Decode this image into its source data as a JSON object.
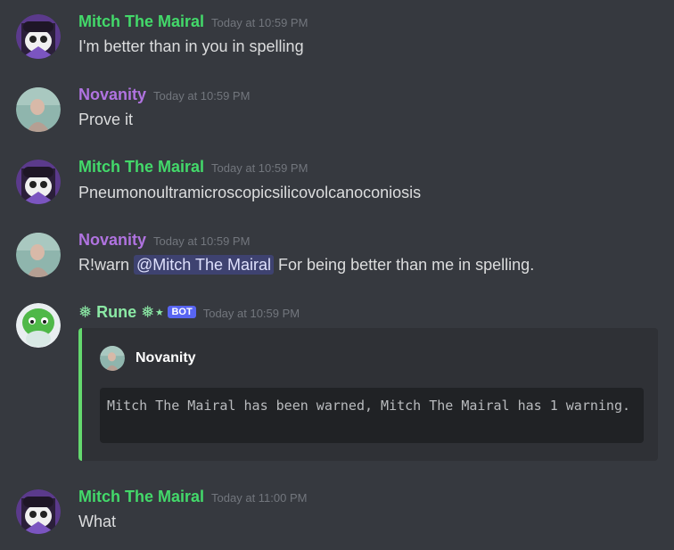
{
  "messages": [
    {
      "author": "Mitch The Mairal",
      "timestamp": "Today at 10:59 PM",
      "text": "I'm better than in you in spelling"
    },
    {
      "author": "Novanity",
      "timestamp": "Today at 10:59 PM",
      "text": "Prove it"
    },
    {
      "author": "Mitch The Mairal",
      "timestamp": "Today at 10:59 PM",
      "text": "Pneumonoultramicroscopicsilicovolcanoconiosis"
    },
    {
      "author": "Novanity",
      "timestamp": "Today at 10:59 PM",
      "text_prefix": "R!warn",
      "mention": "@Mitch The Mairal",
      "text_suffix": "For being better than me in spelling."
    },
    {
      "author": "Rune",
      "author_decor_left": "❅",
      "author_decor_right": "❅⋆",
      "badge": "BOT",
      "timestamp": "Today at 10:59 PM",
      "embed": {
        "author": "Novanity",
        "code": "Mitch The Mairal has been warned, Mitch The Mairal has 1 warning."
      }
    },
    {
      "author": "Mitch The Mairal",
      "timestamp": "Today at 11:00 PM",
      "text": "What"
    }
  ],
  "colors": {
    "background": "#36393f",
    "mitch_name": "#43d96a",
    "novanity_name": "#b073e0",
    "rune_name": "#8be9a5",
    "embed_border": "#64d86e",
    "mention_bg": "#3e4270",
    "bot_badge": "#5865f2"
  },
  "icons": {
    "mitch_avatar": "mitch-avatar",
    "novanity_avatar": "novanity-avatar",
    "rune_avatar": "rune-avatar"
  }
}
